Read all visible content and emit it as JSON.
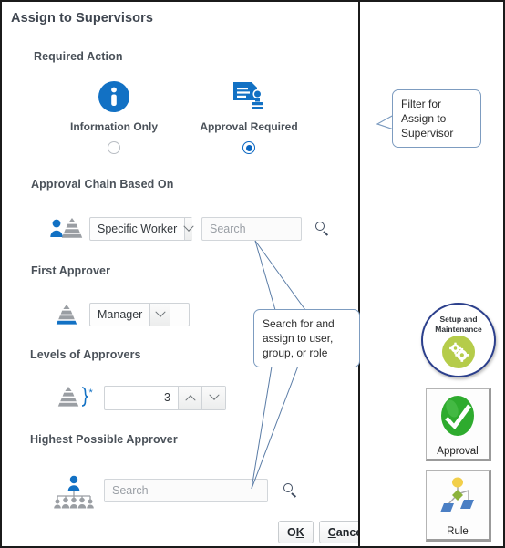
{
  "dialog": {
    "title": "Assign to Supervisors",
    "required_action": {
      "label": "Required Action",
      "options": [
        {
          "caption": "Information Only",
          "icon": "info-circle-icon",
          "selected": false
        },
        {
          "caption": "Approval Required",
          "icon": "document-stamp-icon",
          "selected": true
        }
      ]
    },
    "approval_chain": {
      "label": "Approval Chain Based On",
      "icon": "person-pyramid-icon",
      "select_value": "Specific Worker",
      "search_placeholder": "Search",
      "search_value": "",
      "search_icon": "magnifier-icon"
    },
    "first_approver": {
      "label": "First Approver",
      "icon": "pyramid-base-highlight-icon",
      "select_value": "Manager"
    },
    "levels_of_approvers": {
      "label": "Levels of Approvers",
      "icon": "pyramid-bracket-required-icon",
      "value": "3",
      "required_marker": "*",
      "increment_icon": "chevron-up-icon",
      "decrement_icon": "chevron-down-icon"
    },
    "highest_approver": {
      "label": "Highest Possible Approver",
      "icon": "org-chart-icon",
      "search_placeholder": "Search",
      "search_value": "",
      "search_icon": "magnifier-icon"
    },
    "footer": {
      "ok": {
        "before": "O",
        "mnemonic": "K",
        "after": ""
      },
      "cancel": {
        "before": "",
        "mnemonic": "C",
        "after": "ancel"
      }
    }
  },
  "annotations": {
    "filter_callout": "Filter for Assign to Supervisor",
    "search_callout": "Search for and assign to user, group, or role"
  },
  "rail": {
    "setup_badge": {
      "line1": "Setup and",
      "line2": "Maintenance",
      "icon": "gears-icon"
    },
    "tiles": [
      {
        "label": "Approval",
        "icon": "green-check-icon"
      },
      {
        "label": "Rule",
        "icon": "rule-flowchart-icon"
      }
    ]
  },
  "colors": {
    "accent_blue": "#0a67c2",
    "icon_gray": "#8a8f94",
    "callout_border": "#7d9cc0",
    "badge_ring": "#2b3f8c",
    "gear_green": "#b5cc4a",
    "check_green": "#2eab2e"
  }
}
